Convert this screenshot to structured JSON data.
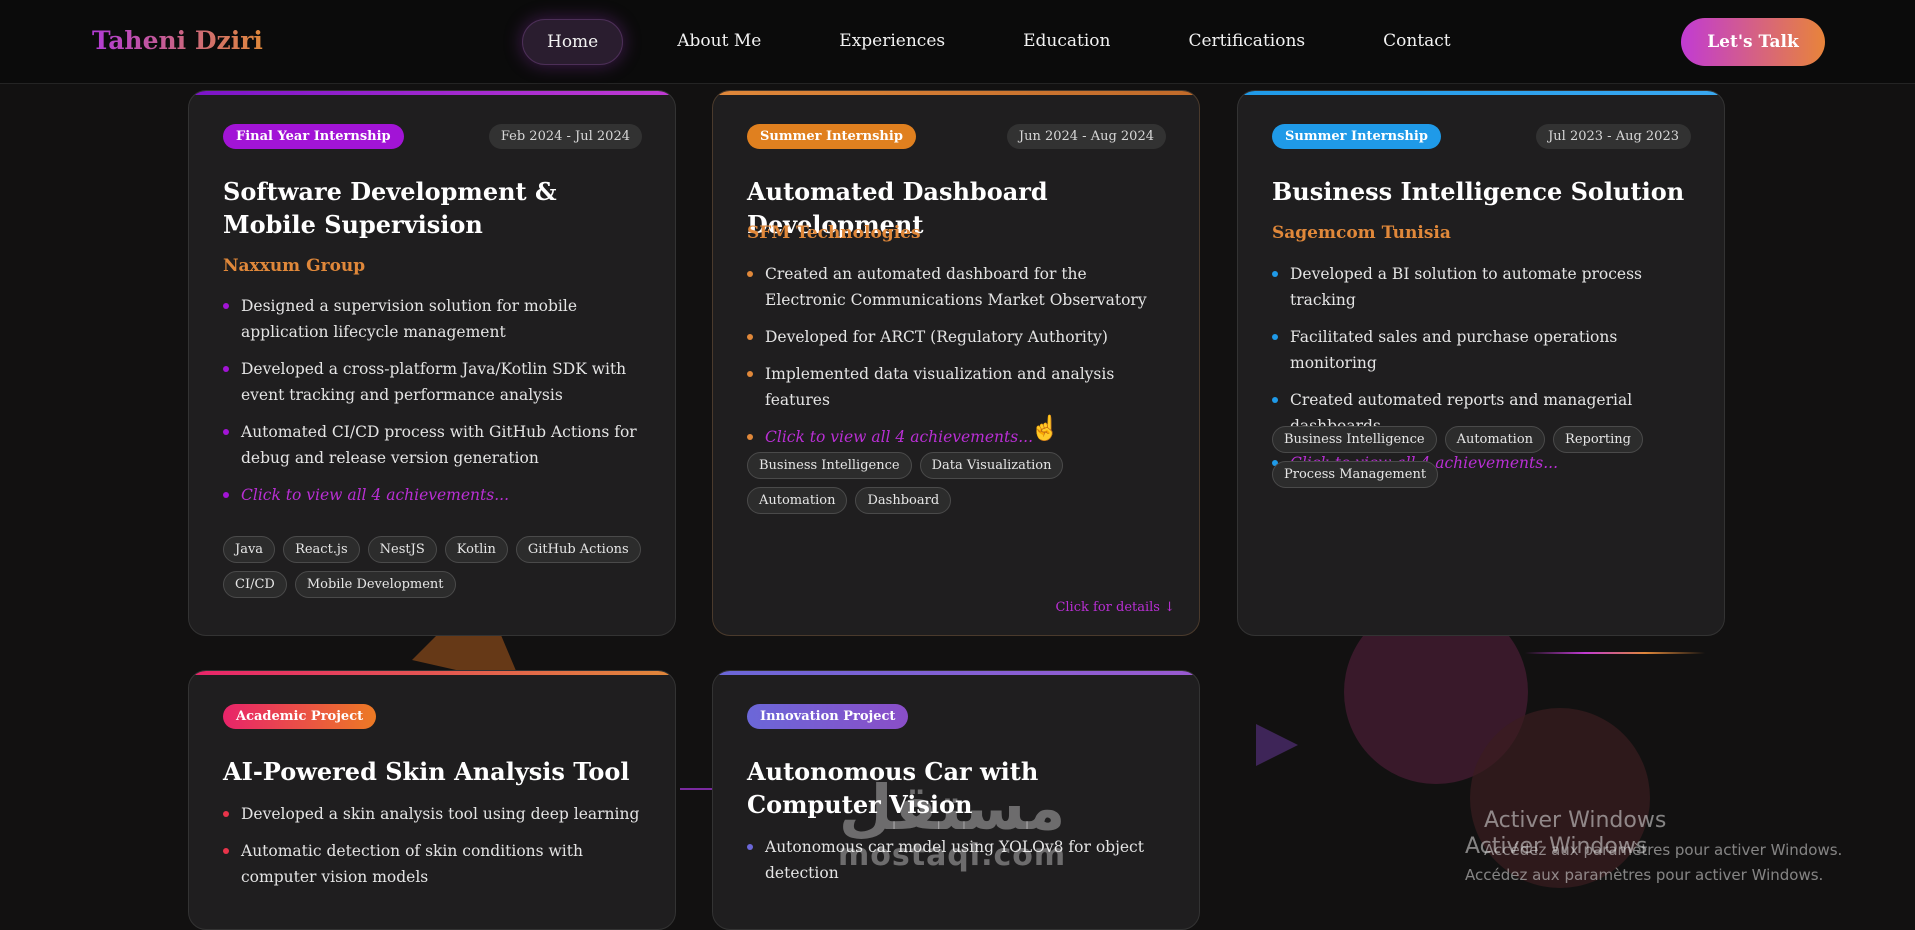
{
  "nav": {
    "brand": "Taheni Dziri",
    "links": [
      "Home",
      "About Me",
      "Experiences",
      "Education",
      "Certifications",
      "Contact"
    ],
    "cta": "Let's Talk"
  },
  "cards": [
    {
      "badge": "Final Year Internship",
      "date": "Feb 2024 - Jul 2024",
      "title": "Software Development & Mobile Supervision",
      "company": "Naxxum Group",
      "achievements": [
        "Designed a supervision solution for mobile application lifecycle management",
        "Developed a cross-platform Java/Kotlin SDK with event tracking and performance analysis",
        "Automated CI/CD process with GitHub Actions for debug and release version generation"
      ],
      "more": "Click to view all 4 achievements...",
      "tags": [
        "Java",
        "React.js",
        "NestJS",
        "Kotlin",
        "GitHub Actions",
        "CI/CD",
        "Mobile Development"
      ]
    },
    {
      "badge": "Summer Internship",
      "date": "Jun 2024 - Aug 2024",
      "title": "Automated Dashboard Development",
      "company": "SFM Technologies",
      "achievements": [
        "Created an automated dashboard for the Electronic Communications Market Observatory",
        "Developed for ARCT (Regulatory Authority)",
        "Implemented data visualization and analysis features"
      ],
      "more": "Click to view all 4 achievements...",
      "tags": [
        "Business Intelligence",
        "Data Visualization",
        "Automation",
        "Dashboard"
      ],
      "details": "Click for details ↓"
    },
    {
      "badge": "Summer Internship",
      "date": "Jul 2023 - Aug 2023",
      "title": "Business Intelligence Solution",
      "company": "Sagemcom Tunisia",
      "achievements": [
        "Developed a BI solution to automate process tracking",
        "Facilitated sales and purchase operations monitoring",
        "Created automated reports and managerial dashboards"
      ],
      "more": "Click to view all 4 achievements...",
      "tags": [
        "Business Intelligence",
        "Automation",
        "Reporting",
        "Process Management"
      ]
    },
    {
      "badge": "Academic Project",
      "title": "AI-Powered Skin Analysis Tool",
      "achievements": [
        "Developed a skin analysis tool using deep learning",
        "Automatic detection of skin conditions with computer vision models"
      ]
    },
    {
      "badge": "Innovation Project",
      "title": "Autonomous Car with Computer Vision",
      "achievements": [
        "Autonomous car model using YOLOv8 for object detection"
      ]
    }
  ],
  "watermark": {
    "arabic": "مستقل",
    "latin": "mostaql.com"
  },
  "activation": {
    "title": "Activer Windows",
    "message": "Accédez aux paramètres pour activer Windows."
  },
  "colors": {
    "background": "#121111",
    "purple": "#a214d6",
    "orange": "#e0883a",
    "blue": "#1f9ae8",
    "pink": "#e8246a",
    "indigo": "#6b67d8"
  }
}
